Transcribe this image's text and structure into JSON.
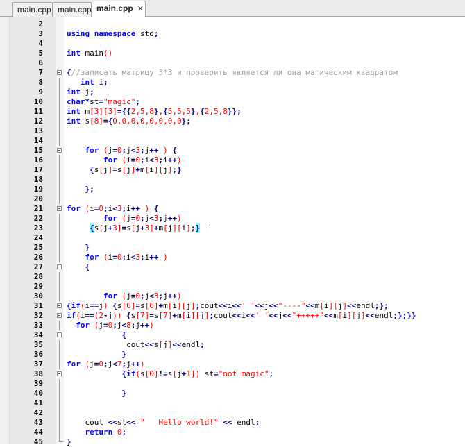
{
  "tabs": [
    {
      "label": "main.cpp",
      "active": false
    },
    {
      "label": "main.cpp",
      "active": false
    },
    {
      "label": "main.cpp",
      "active": true,
      "close": "✕"
    }
  ],
  "lines": [
    {
      "n": "2",
      "code": ""
    },
    {
      "n": "3",
      "code": "using namespace std;"
    },
    {
      "n": "4",
      "code": ""
    },
    {
      "n": "5",
      "code": "int main()"
    },
    {
      "n": "6",
      "code": ""
    },
    {
      "n": "7",
      "code": "{//записать матрицу 3*3 и проверить является ли она магическим квадратом"
    },
    {
      "n": "8",
      "code": "   int i;"
    },
    {
      "n": "9",
      "code": "int j;"
    },
    {
      "n": "10",
      "code": "char*st=\"magic\";"
    },
    {
      "n": "11",
      "code": "int m[3][3]={{2,5,8},{5,5,5},{2,5,8}};"
    },
    {
      "n": "12",
      "code": "int s[8]={0,0,0,0,0,0,0,0};"
    },
    {
      "n": "13",
      "code": ""
    },
    {
      "n": "14",
      "code": ""
    },
    {
      "n": "15",
      "code": "    for (j=0;j<3;j++ ) {"
    },
    {
      "n": "16",
      "code": "        for (i=0;i<3;i++)"
    },
    {
      "n": "17",
      "code": "     {s[j]=s[j]+m[i][j];}"
    },
    {
      "n": "18",
      "code": ""
    },
    {
      "n": "19",
      "code": "    };"
    },
    {
      "n": "20",
      "code": ""
    },
    {
      "n": "21",
      "code": "for (i=0;i<3;i++ ) {"
    },
    {
      "n": "22",
      "code": "        for (j=0;j<3;j++)"
    },
    {
      "n": "23",
      "code": "     {s[j+3]=s[j+3]+m[j][i];}"
    },
    {
      "n": "24",
      "code": ""
    },
    {
      "n": "25",
      "code": "    }"
    },
    {
      "n": "26",
      "code": "    for (i=0;i<3;i++ )"
    },
    {
      "n": "27",
      "code": "    {"
    },
    {
      "n": "28",
      "code": ""
    },
    {
      "n": "29",
      "code": ""
    },
    {
      "n": "30",
      "code": "        for (j=0;j<3;j++)"
    },
    {
      "n": "31",
      "code": "{if(i==j) {s[6]=s[6]+m[i][j];cout<<i<<' '<<j<<\"----\"<<m[i][j]<<endl;};"
    },
    {
      "n": "32",
      "code": "if(i==(2-j)) {s[7]=s[7]+m[i][j];cout<<i<<' '<<j<<\"+++++\"<<m[i][j]<<endl;};}}"
    },
    {
      "n": "33",
      "code": "  for (j=0;j<8;j++)"
    },
    {
      "n": "34",
      "code": "            {"
    },
    {
      "n": "35",
      "code": "             cout<<s[j]<<endl;"
    },
    {
      "n": "36",
      "code": "            }"
    },
    {
      "n": "37",
      "code": "for (j=0;j<7;j++)"
    },
    {
      "n": "38",
      "code": "            {if(s[0]!=s[j+1]) st=\"not magic\";"
    },
    {
      "n": "39",
      "code": ""
    },
    {
      "n": "40",
      "code": "            }"
    },
    {
      "n": "41",
      "code": ""
    },
    {
      "n": "42",
      "code": ""
    },
    {
      "n": "43",
      "code": "    cout <<st<< \"   Hello world!\" << endl;"
    },
    {
      "n": "44",
      "code": "    return 0;"
    },
    {
      "n": "45",
      "code": "}"
    }
  ]
}
